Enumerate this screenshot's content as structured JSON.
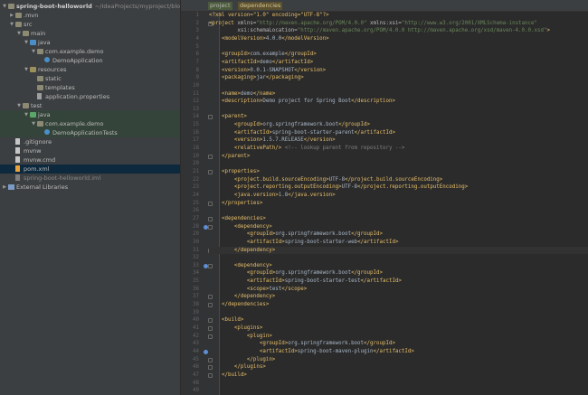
{
  "project_tree": {
    "root": {
      "label": "spring-boot-helloworld",
      "path": "~/IdeaProjects/myproject/blog-ex"
    },
    "items": [
      {
        "label": ".mvn",
        "depth": 1,
        "kind": "folder",
        "arrow": "▶"
      },
      {
        "label": "src",
        "depth": 1,
        "kind": "folder",
        "arrow": "▼"
      },
      {
        "label": "main",
        "depth": 2,
        "kind": "folder",
        "arrow": "▼"
      },
      {
        "label": "java",
        "depth": 3,
        "kind": "folder-src",
        "arrow": "▼"
      },
      {
        "label": "com.example.demo",
        "depth": 4,
        "kind": "folder-pkg",
        "arrow": "▼"
      },
      {
        "label": "DemoApplication",
        "depth": 5,
        "kind": "class",
        "arrow": ""
      },
      {
        "label": "resources",
        "depth": 3,
        "kind": "folder-res",
        "arrow": "▼"
      },
      {
        "label": "static",
        "depth": 4,
        "kind": "folder",
        "arrow": ""
      },
      {
        "label": "templates",
        "depth": 4,
        "kind": "folder",
        "arrow": ""
      },
      {
        "label": "application.properties",
        "depth": 4,
        "kind": "prop",
        "arrow": ""
      },
      {
        "label": "test",
        "depth": 2,
        "kind": "folder",
        "arrow": "▼"
      },
      {
        "label": "java",
        "depth": 3,
        "kind": "folder-test",
        "arrow": "▼"
      },
      {
        "label": "com.example.demo",
        "depth": 4,
        "kind": "folder-pkg",
        "arrow": "▼"
      },
      {
        "label": "DemoApplicationTests",
        "depth": 5,
        "kind": "class",
        "arrow": ""
      },
      {
        "label": ".gitignore",
        "depth": 1,
        "kind": "file",
        "arrow": ""
      },
      {
        "label": "mvnw",
        "depth": 1,
        "kind": "file",
        "arrow": ""
      },
      {
        "label": "mvnw.cmd",
        "depth": 1,
        "kind": "file",
        "arrow": ""
      },
      {
        "label": "pom.xml",
        "depth": 1,
        "kind": "xml",
        "arrow": "",
        "selected": true
      },
      {
        "label": "spring-boot-helloworld.iml",
        "depth": 1,
        "kind": "iml",
        "arrow": ""
      },
      {
        "label": "External Libraries",
        "depth": 0,
        "kind": "lib",
        "arrow": "▶"
      }
    ]
  },
  "breadcrumbs": [
    "project",
    "dependencies"
  ],
  "code": [
    [
      [
        "pi",
        "<?xml version=\"1.0\" encoding=\"UTF-8\"?>"
      ]
    ],
    [
      [
        "tag",
        "<project "
      ],
      [
        "attr",
        "xmlns="
      ],
      [
        "val",
        "\"http://maven.apache.org/POM/4.0.0\""
      ],
      [
        "attr",
        " xmlns:xsi="
      ],
      [
        "val",
        "\"http://www.w3.org/2001/XMLSchema-instance\""
      ]
    ],
    [
      [
        "attr",
        "         xsi:schemaLocation="
      ],
      [
        "val",
        "\"http://maven.apache.org/POM/4.0.0 http://maven.apache.org/xsd/maven-4.0.0.xsd\""
      ],
      [
        "tag",
        ">"
      ]
    ],
    [
      [
        "text",
        "    "
      ],
      [
        "tag",
        "<modelVersion>"
      ],
      [
        "text",
        "4.0.0"
      ],
      [
        "tag",
        "</modelVersion>"
      ]
    ],
    [
      [
        "text",
        ""
      ]
    ],
    [
      [
        "text",
        "    "
      ],
      [
        "tag",
        "<groupId>"
      ],
      [
        "text",
        "com.example"
      ],
      [
        "tag",
        "</groupId>"
      ]
    ],
    [
      [
        "text",
        "    "
      ],
      [
        "tag",
        "<artifactId>"
      ],
      [
        "text",
        "demo"
      ],
      [
        "tag",
        "</artifactId>"
      ]
    ],
    [
      [
        "text",
        "    "
      ],
      [
        "tag",
        "<version>"
      ],
      [
        "text",
        "0.0.1-SNAPSHOT"
      ],
      [
        "tag",
        "</version>"
      ]
    ],
    [
      [
        "text",
        "    "
      ],
      [
        "tag",
        "<packaging>"
      ],
      [
        "text",
        "jar"
      ],
      [
        "tag",
        "</packaging>"
      ]
    ],
    [
      [
        "text",
        ""
      ]
    ],
    [
      [
        "text",
        "    "
      ],
      [
        "tag",
        "<name>"
      ],
      [
        "text",
        "demo"
      ],
      [
        "tag",
        "</name>"
      ]
    ],
    [
      [
        "text",
        "    "
      ],
      [
        "tag",
        "<description>"
      ],
      [
        "text",
        "Demo project for Spring Boot"
      ],
      [
        "tag",
        "</description>"
      ]
    ],
    [
      [
        "text",
        ""
      ]
    ],
    [
      [
        "text",
        "    "
      ],
      [
        "tag",
        "<parent>"
      ]
    ],
    [
      [
        "text",
        "        "
      ],
      [
        "tag",
        "<groupId>"
      ],
      [
        "text",
        "org.springframework.boot"
      ],
      [
        "tag",
        "</groupId>"
      ]
    ],
    [
      [
        "text",
        "        "
      ],
      [
        "tag",
        "<artifactId>"
      ],
      [
        "text",
        "spring-boot-starter-parent"
      ],
      [
        "tag",
        "</artifactId>"
      ]
    ],
    [
      [
        "text",
        "        "
      ],
      [
        "tag",
        "<version>"
      ],
      [
        "text",
        "1.5.7.RELEASE"
      ],
      [
        "tag",
        "</version>"
      ]
    ],
    [
      [
        "text",
        "        "
      ],
      [
        "tag",
        "<relativePath/>"
      ],
      [
        "com",
        " <!-- lookup parent from repository -->"
      ]
    ],
    [
      [
        "text",
        "    "
      ],
      [
        "tag",
        "</parent>"
      ]
    ],
    [
      [
        "text",
        ""
      ]
    ],
    [
      [
        "text",
        "    "
      ],
      [
        "tag",
        "<properties>"
      ]
    ],
    [
      [
        "text",
        "        "
      ],
      [
        "tag",
        "<project.build.sourceEncoding>"
      ],
      [
        "text",
        "UTF-8"
      ],
      [
        "tag",
        "</project.build.sourceEncoding>"
      ]
    ],
    [
      [
        "text",
        "        "
      ],
      [
        "tag",
        "<project.reporting.outputEncoding>"
      ],
      [
        "text",
        "UTF-8"
      ],
      [
        "tag",
        "</project.reporting.outputEncoding>"
      ]
    ],
    [
      [
        "text",
        "        "
      ],
      [
        "tag",
        "<java.version>"
      ],
      [
        "text",
        "1.8"
      ],
      [
        "tag",
        "</java.version>"
      ]
    ],
    [
      [
        "text",
        "    "
      ],
      [
        "tag",
        "</properties>"
      ]
    ],
    [
      [
        "text",
        ""
      ]
    ],
    [
      [
        "text",
        "    "
      ],
      [
        "tag",
        "<dependencies>"
      ]
    ],
    [
      [
        "text",
        "        "
      ],
      [
        "tag",
        "<dependency>"
      ]
    ],
    [
      [
        "text",
        "            "
      ],
      [
        "tag",
        "<groupId>"
      ],
      [
        "text",
        "org.springframework.boot"
      ],
      [
        "tag",
        "</groupId>"
      ]
    ],
    [
      [
        "text",
        "            "
      ],
      [
        "tag",
        "<artifactId>"
      ],
      [
        "text",
        "spring-boot-starter-web"
      ],
      [
        "tag",
        "</artifactId>"
      ]
    ],
    [
      [
        "text",
        "        "
      ],
      [
        "tag",
        "</dependency>"
      ]
    ],
    [
      [
        "text",
        ""
      ]
    ],
    [
      [
        "text",
        "        "
      ],
      [
        "tag",
        "<dependency>"
      ]
    ],
    [
      [
        "text",
        "            "
      ],
      [
        "tag",
        "<groupId>"
      ],
      [
        "text",
        "org.springframework.boot"
      ],
      [
        "tag",
        "</groupId>"
      ]
    ],
    [
      [
        "text",
        "            "
      ],
      [
        "tag",
        "<artifactId>"
      ],
      [
        "text",
        "spring-boot-starter-test"
      ],
      [
        "tag",
        "</artifactId>"
      ]
    ],
    [
      [
        "text",
        "            "
      ],
      [
        "tag",
        "<scope>"
      ],
      [
        "text",
        "test"
      ],
      [
        "tag",
        "</scope>"
      ]
    ],
    [
      [
        "text",
        "        "
      ],
      [
        "tag",
        "</dependency>"
      ]
    ],
    [
      [
        "text",
        "    "
      ],
      [
        "tag",
        "</dependencies>"
      ]
    ],
    [
      [
        "text",
        ""
      ]
    ],
    [
      [
        "text",
        "    "
      ],
      [
        "tag",
        "<build>"
      ]
    ],
    [
      [
        "text",
        "        "
      ],
      [
        "tag",
        "<plugins>"
      ]
    ],
    [
      [
        "text",
        "            "
      ],
      [
        "tag",
        "<plugin>"
      ]
    ],
    [
      [
        "text",
        "                "
      ],
      [
        "tag",
        "<groupId>"
      ],
      [
        "text",
        "org.springframework.boot"
      ],
      [
        "tag",
        "</groupId>"
      ]
    ],
    [
      [
        "text",
        "                "
      ],
      [
        "tag",
        "<artifactId>"
      ],
      [
        "text",
        "spring-boot-maven-plugin"
      ],
      [
        "tag",
        "</artifactId>"
      ]
    ],
    [
      [
        "text",
        "            "
      ],
      [
        "tag",
        "</plugin>"
      ]
    ],
    [
      [
        "text",
        "        "
      ],
      [
        "tag",
        "</plugins>"
      ]
    ],
    [
      [
        "text",
        "    "
      ],
      [
        "tag",
        "</build>"
      ]
    ],
    [
      [
        "text",
        ""
      ]
    ],
    [
      [
        "text",
        ""
      ]
    ],
    [
      [
        "tag",
        "</project>"
      ]
    ]
  ],
  "gutter": {
    "fold_lines": [
      2,
      14,
      19,
      21,
      25,
      27,
      28,
      31,
      33,
      37,
      38,
      40,
      41,
      42,
      45,
      46,
      47,
      50
    ],
    "mark_lines": [
      28,
      33,
      44
    ],
    "bulb_lines": [
      31
    ],
    "caret_line": 31
  }
}
